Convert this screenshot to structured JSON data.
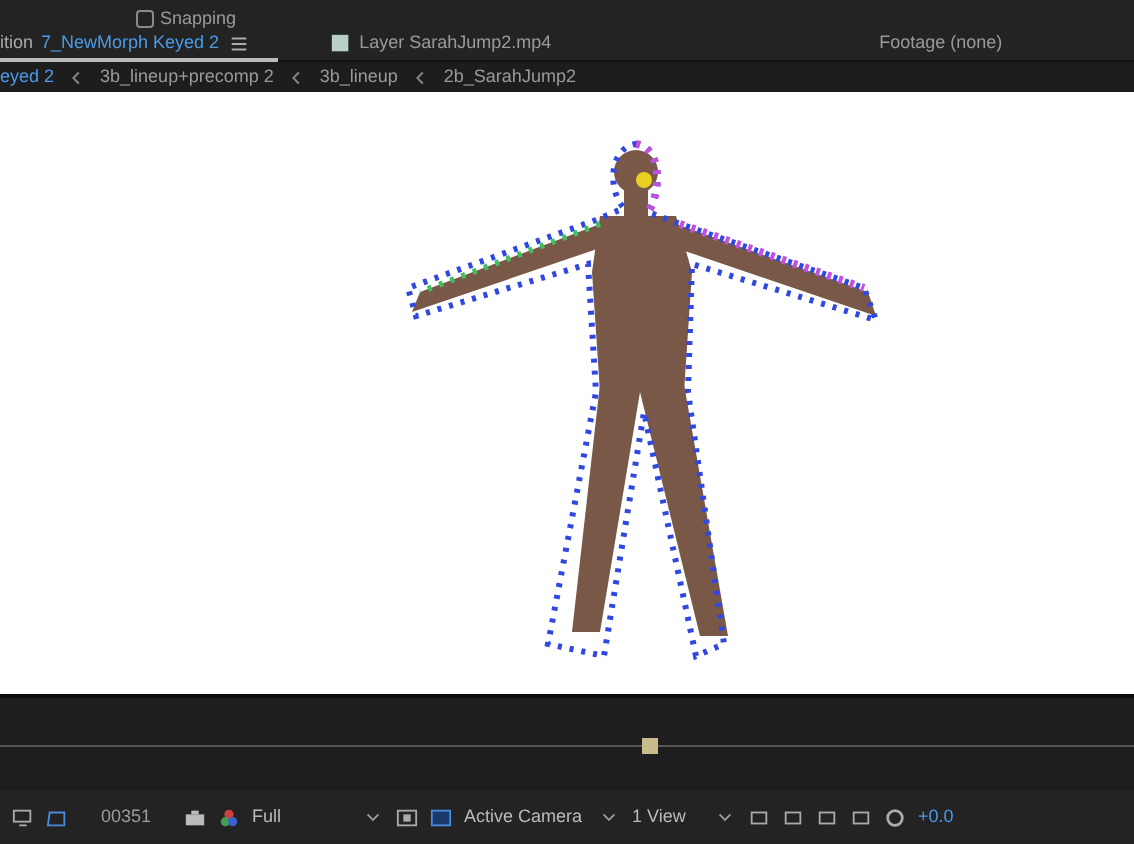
{
  "toolbar": {
    "snapping": {
      "label": "Snapping",
      "checked": false
    }
  },
  "tabs": [
    {
      "kind": "composition",
      "prefix": "ition",
      "label": "7_NewMorph Keyed 2",
      "selected": true
    },
    {
      "kind": "layer",
      "label": "Layer SarahJump2.mp4",
      "selected": false
    },
    {
      "kind": "footage",
      "label": "Footage (none)",
      "selected": false
    }
  ],
  "breadcrumbs": [
    {
      "label": "eyed 2",
      "selected": true
    },
    {
      "label": "3b_lineup+precomp 2",
      "selected": false
    },
    {
      "label": "3b_lineup",
      "selected": false
    },
    {
      "label": "2b_SarahJump2",
      "selected": false
    }
  ],
  "viewer_controls": {
    "timecode": "00351",
    "resolution": "Full",
    "camera": "Active Camera",
    "views": "1 View",
    "exposure": "+0.0"
  }
}
